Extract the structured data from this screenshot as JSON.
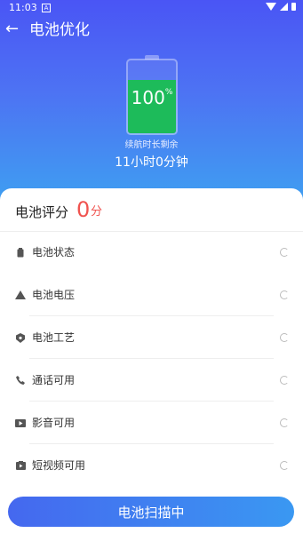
{
  "status_bar": {
    "time": "11:03",
    "notification_icon": "A"
  },
  "header": {
    "title": "电池优化",
    "back_icon": "arrow-left"
  },
  "battery": {
    "level": "100",
    "percent_sign": "%",
    "remaining_label": "续航时长剩余",
    "remaining_time": "11小时0分钟",
    "fill_fraction": 1.0
  },
  "score": {
    "label": "电池评分",
    "value": "0",
    "unit": "分"
  },
  "checks": [
    {
      "label": "电池状态",
      "icon": "battery-icon"
    },
    {
      "label": "电池电压",
      "icon": "warning-triangle-icon"
    },
    {
      "label": "电池工艺",
      "icon": "shield-icon"
    },
    {
      "label": "通话可用",
      "icon": "phone-icon"
    },
    {
      "label": "影音可用",
      "icon": "play-icon"
    },
    {
      "label": "短视频可用",
      "icon": "video-icon"
    }
  ],
  "action": {
    "scan_label": "电池扫描中"
  },
  "colors": {
    "accent": "#4a55f5",
    "battery_fill": "#1dbb5a",
    "score": "#f0534f"
  }
}
